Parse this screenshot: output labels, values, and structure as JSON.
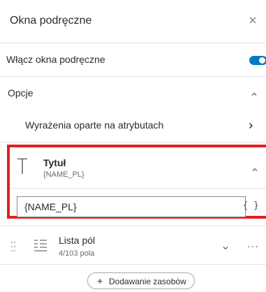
{
  "header": {
    "title": "Okna podręczne",
    "close_icon": "close-icon"
  },
  "toggle": {
    "label": "Włącz okna podręczne",
    "on": true,
    "color": "#007ac2"
  },
  "options": {
    "title": "Opcje",
    "expanded": true,
    "expressions_label": "Wyrażenia oparte na atrybutach"
  },
  "title_block": {
    "title": "Tytuł",
    "subtitle": "{NAME_PL}",
    "input_value": "{NAME_PL}",
    "expression_icon": "{ }",
    "highlight_color": "#e02020"
  },
  "fields_list": {
    "title": "Lista pól",
    "subtitle": "4/103 pola",
    "more_icon": "···"
  },
  "add_button": {
    "plus": "+",
    "label": "Dodawanie zasobów"
  }
}
